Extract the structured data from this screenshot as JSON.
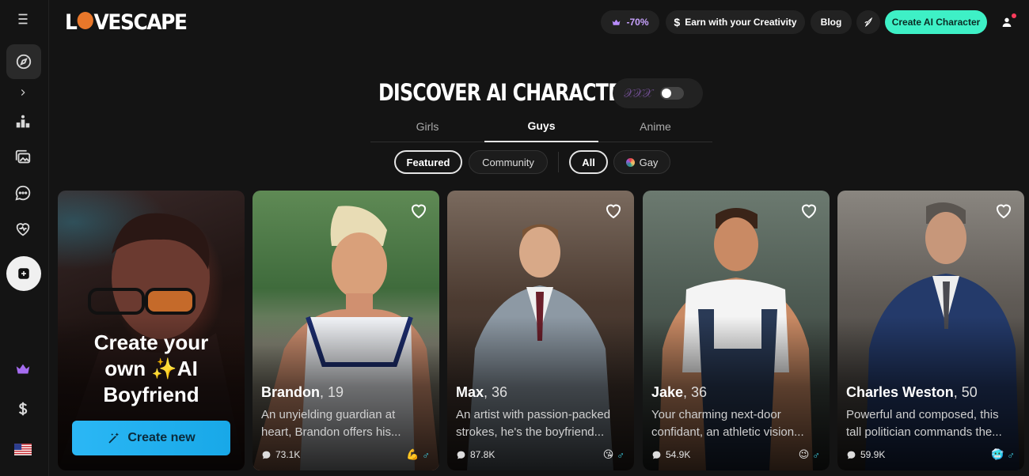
{
  "brand": {
    "logo_text_a": "L",
    "logo_text_b": "VESCAPE"
  },
  "topbar": {
    "promo": "-70%",
    "earn": "Earn with your Creativity",
    "blog": "Blog",
    "create": "Create AI Character"
  },
  "page": {
    "title": "DISCOVER AI CHARACTERS",
    "toggle_blur": "𝒳𝒳𝒳"
  },
  "tabs": [
    {
      "label": "Girls"
    },
    {
      "label": "Guys"
    },
    {
      "label": "Anime"
    }
  ],
  "filters": {
    "featured": "Featured",
    "community": "Community",
    "all": "All",
    "gay": "Gay"
  },
  "promo_card": {
    "line1": "Create your",
    "line2": "own ✨AI",
    "line3": "Boyfriend",
    "button": "Create new"
  },
  "characters": [
    {
      "name": "Brandon",
      "age": ", 19",
      "desc": "An unyielding guardian at heart, Brandon offers his...",
      "chats": "73.1K",
      "emoji": "💪",
      "gender": "♂"
    },
    {
      "name": "Max",
      "age": ", 36",
      "desc": "An artist with passion-packed strokes, he's the boyfriend...",
      "chats": "87.8K",
      "emoji": "😘",
      "gender": "♂"
    },
    {
      "name": "Jake",
      "age": ", 36",
      "desc": "Your charming next-door confidant, an athletic vision...",
      "chats": "54.9K",
      "emoji": "😉",
      "gender": "♂"
    },
    {
      "name": "Charles Weston",
      "age": ", 50",
      "desc": "Powerful and composed, this tall politician commands the...",
      "chats": "59.9K",
      "emoji": "🥶",
      "gender": "♂"
    }
  ],
  "colors": {
    "accent": "#3ef0c6",
    "create_btn": "#2bb7f5",
    "promo": "#c8a2ff",
    "gender": "#3fd3e8"
  }
}
